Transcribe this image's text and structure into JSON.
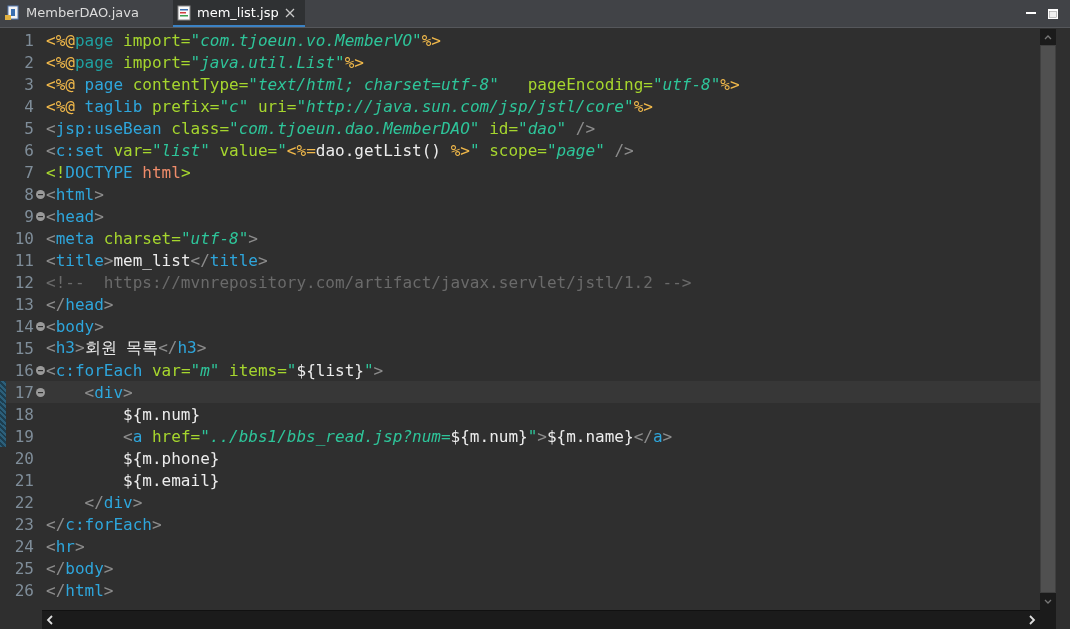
{
  "tabs": [
    {
      "label": "MemberDAO.java",
      "kind": "java",
      "selected": false,
      "closable": false
    },
    {
      "label": "mem_list.jsp",
      "kind": "jsp",
      "selected": true,
      "closable": true
    }
  ],
  "editor": {
    "lines": [
      {
        "number": "1",
        "tokens": [
          {
            "kind": "dir",
            "text": "<%@"
          },
          {
            "kind": "dirname",
            "text": "page"
          },
          {
            "kind": "attr",
            "text": " import="
          },
          {
            "kind": "str",
            "text": "\"com.tjoeun.vo.MemberVO\""
          },
          {
            "kind": "dir",
            "text": "%>"
          }
        ]
      },
      {
        "number": "2",
        "tokens": [
          {
            "kind": "dir",
            "text": "<%@"
          },
          {
            "kind": "dirname",
            "text": "page"
          },
          {
            "kind": "attr",
            "text": " import="
          },
          {
            "kind": "str",
            "text": "\"java.util.List\""
          },
          {
            "kind": "dir",
            "text": "%>"
          }
        ]
      },
      {
        "number": "3",
        "tokens": [
          {
            "kind": "dir",
            "text": "<%@"
          },
          {
            "kind": "tag",
            "text": " page"
          },
          {
            "kind": "attr",
            "text": " contentType="
          },
          {
            "kind": "str",
            "text": "\"text/html; charset=utf-8\""
          },
          {
            "kind": "attr",
            "text": "   pageEncoding="
          },
          {
            "kind": "str",
            "text": "\"utf-8\""
          },
          {
            "kind": "dir",
            "text": "%>"
          }
        ]
      },
      {
        "number": "4",
        "tokens": [
          {
            "kind": "dir",
            "text": "<%@"
          },
          {
            "kind": "tag",
            "text": " taglib"
          },
          {
            "kind": "attr",
            "text": " prefix="
          },
          {
            "kind": "str",
            "text": "\"c\""
          },
          {
            "kind": "attr",
            "text": " uri="
          },
          {
            "kind": "str",
            "text": "\"http://java.sun.com/jsp/jstl/core\""
          },
          {
            "kind": "dir",
            "text": "%>"
          }
        ]
      },
      {
        "number": "5",
        "tokens": [
          {
            "kind": "br",
            "text": "<"
          },
          {
            "kind": "tag",
            "text": "jsp:useBean"
          },
          {
            "kind": "attr",
            "text": " class="
          },
          {
            "kind": "str",
            "text": "\"com.tjoeun.dao.MemberDAO\""
          },
          {
            "kind": "attr",
            "text": " id="
          },
          {
            "kind": "str",
            "text": "\"dao\""
          },
          {
            "kind": "br",
            "text": " />"
          }
        ]
      },
      {
        "number": "6",
        "tokens": [
          {
            "kind": "br",
            "text": "<"
          },
          {
            "kind": "tag",
            "text": "c:set"
          },
          {
            "kind": "attr",
            "text": " var="
          },
          {
            "kind": "str",
            "text": "\"list\""
          },
          {
            "kind": "attr",
            "text": " value="
          },
          {
            "kind": "str",
            "text": "\""
          },
          {
            "kind": "dir",
            "text": "<%="
          },
          {
            "kind": "plain",
            "text": "dao.getList() "
          },
          {
            "kind": "dir",
            "text": "%>"
          },
          {
            "kind": "str",
            "text": "\""
          },
          {
            "kind": "attr",
            "text": " scope="
          },
          {
            "kind": "str",
            "text": "\"page\""
          },
          {
            "kind": "br",
            "text": " />"
          }
        ]
      },
      {
        "number": "7",
        "tokens": [
          {
            "kind": "decl",
            "text": "<!"
          },
          {
            "kind": "tag",
            "text": "DOCTYPE"
          },
          {
            "kind": "doc",
            "text": " html"
          },
          {
            "kind": "decl",
            "text": ">"
          }
        ]
      },
      {
        "number": "8",
        "fold": true,
        "tokens": [
          {
            "kind": "br",
            "text": "<"
          },
          {
            "kind": "tag",
            "text": "html"
          },
          {
            "kind": "br",
            "text": ">"
          }
        ]
      },
      {
        "number": "9",
        "fold": true,
        "tokens": [
          {
            "kind": "br",
            "text": "<"
          },
          {
            "kind": "tag",
            "text": "head"
          },
          {
            "kind": "br",
            "text": ">"
          }
        ]
      },
      {
        "number": "10",
        "tokens": [
          {
            "kind": "br",
            "text": "<"
          },
          {
            "kind": "tag",
            "text": "meta"
          },
          {
            "kind": "attr",
            "text": " charset="
          },
          {
            "kind": "str",
            "text": "\"utf-8\""
          },
          {
            "kind": "br",
            "text": ">"
          }
        ]
      },
      {
        "number": "11",
        "tokens": [
          {
            "kind": "br",
            "text": "<"
          },
          {
            "kind": "tag",
            "text": "title"
          },
          {
            "kind": "br",
            "text": ">"
          },
          {
            "kind": "plain",
            "text": "mem_list"
          },
          {
            "kind": "br",
            "text": "</"
          },
          {
            "kind": "tag",
            "text": "title"
          },
          {
            "kind": "br",
            "text": ">"
          }
        ]
      },
      {
        "number": "12",
        "tokens": [
          {
            "kind": "comment",
            "text": "<!--  https://mvnrepository.com/artifact/javax.servlet/jstl/1.2 -->"
          }
        ]
      },
      {
        "number": "13",
        "tokens": [
          {
            "kind": "br",
            "text": "</"
          },
          {
            "kind": "tag",
            "text": "head"
          },
          {
            "kind": "br",
            "text": ">"
          }
        ]
      },
      {
        "number": "14",
        "fold": true,
        "tokens": [
          {
            "kind": "br",
            "text": "<"
          },
          {
            "kind": "tag",
            "text": "body"
          },
          {
            "kind": "br",
            "text": ">"
          }
        ]
      },
      {
        "number": "15",
        "tokens": [
          {
            "kind": "br",
            "text": "<"
          },
          {
            "kind": "tag",
            "text": "h3"
          },
          {
            "kind": "br",
            "text": ">"
          },
          {
            "kind": "plain",
            "text": "회원 목록"
          },
          {
            "kind": "br",
            "text": "</"
          },
          {
            "kind": "tag",
            "text": "h3"
          },
          {
            "kind": "br",
            "text": ">"
          }
        ]
      },
      {
        "number": "16",
        "fold": true,
        "tokens": [
          {
            "kind": "br",
            "text": "<"
          },
          {
            "kind": "tag",
            "text": "c:forEach"
          },
          {
            "kind": "attr",
            "text": " var="
          },
          {
            "kind": "str",
            "text": "\"m\""
          },
          {
            "kind": "attr",
            "text": " items="
          },
          {
            "kind": "str",
            "text": "\""
          },
          {
            "kind": "plain",
            "text": "${list}"
          },
          {
            "kind": "str",
            "text": "\""
          },
          {
            "kind": "br",
            "text": ">"
          }
        ]
      },
      {
        "number": "17",
        "fold": true,
        "current": true,
        "changed": true,
        "tokens": [
          {
            "kind": "br",
            "text": "    <"
          },
          {
            "kind": "tag",
            "text": "div"
          },
          {
            "kind": "br",
            "text": ">"
          }
        ]
      },
      {
        "number": "18",
        "changed": true,
        "tokens": [
          {
            "kind": "plain",
            "text": "        ${m.num}"
          }
        ]
      },
      {
        "number": "19",
        "changed": true,
        "tokens": [
          {
            "kind": "br",
            "text": "        <"
          },
          {
            "kind": "tag",
            "text": "a"
          },
          {
            "kind": "attr",
            "text": " href="
          },
          {
            "kind": "str",
            "text": "\"../bbs1/bbs_read.jsp?num="
          },
          {
            "kind": "plain",
            "text": "${m.num}"
          },
          {
            "kind": "str",
            "text": "\""
          },
          {
            "kind": "br",
            "text": ">"
          },
          {
            "kind": "plain",
            "text": "${m.name}"
          },
          {
            "kind": "br",
            "text": "</"
          },
          {
            "kind": "tag",
            "text": "a"
          },
          {
            "kind": "br",
            "text": ">"
          }
        ]
      },
      {
        "number": "20",
        "tokens": [
          {
            "kind": "plain",
            "text": "        ${m.phone}"
          }
        ]
      },
      {
        "number": "21",
        "tokens": [
          {
            "kind": "plain",
            "text": "        ${m.email}"
          }
        ]
      },
      {
        "number": "22",
        "tokens": [
          {
            "kind": "br",
            "text": "    </"
          },
          {
            "kind": "tag",
            "text": "div"
          },
          {
            "kind": "br",
            "text": ">"
          }
        ]
      },
      {
        "number": "23",
        "tokens": [
          {
            "kind": "br",
            "text": "</"
          },
          {
            "kind": "tag",
            "text": "c:forEach"
          },
          {
            "kind": "br",
            "text": ">"
          }
        ]
      },
      {
        "number": "24",
        "tokens": [
          {
            "kind": "br",
            "text": "<"
          },
          {
            "kind": "tag",
            "text": "hr"
          },
          {
            "kind": "br",
            "text": ">"
          }
        ]
      },
      {
        "number": "25",
        "tokens": [
          {
            "kind": "br",
            "text": "</"
          },
          {
            "kind": "tag",
            "text": "body"
          },
          {
            "kind": "br",
            "text": ">"
          }
        ]
      },
      {
        "number": "26",
        "tokens": [
          {
            "kind": "br",
            "text": "</"
          },
          {
            "kind": "tag",
            "text": "html"
          },
          {
            "kind": "br",
            "text": ">"
          }
        ]
      }
    ]
  }
}
